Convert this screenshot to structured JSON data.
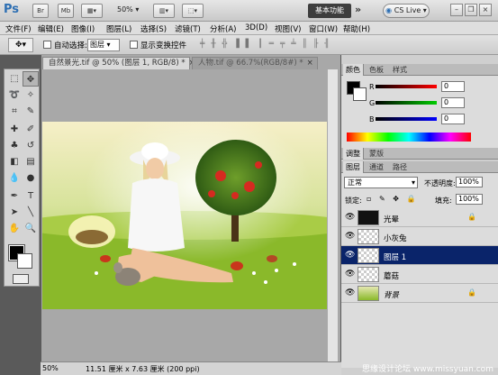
{
  "app": {
    "logo": "Ps",
    "zoom": "50%",
    "workspace": "基本功能",
    "cs_live": "CS Live",
    "titlebar_buttons": [
      "Br",
      "Mb"
    ]
  },
  "menu": [
    "文件(F)",
    "编辑(E)",
    "图像(I)",
    "图层(L)",
    "选择(S)",
    "滤镜(T)",
    "分析(A)",
    "3D(D)",
    "视图(V)",
    "窗口(W)",
    "帮助(H)"
  ],
  "options": {
    "auto_select_label": "自动选择:",
    "auto_select_value": "图层",
    "show_transform_label": "显示变换控件"
  },
  "tabs": [
    {
      "label": "自然景光.tif @ 50% (图层 1, RGB/8) *",
      "close": "×"
    },
    {
      "label": "人物.tif @ 66.7%(RGB/8#) *",
      "close": "×"
    }
  ],
  "status": {
    "zoom": "50%",
    "info": "11.51 厘米 x 7.63 厘米 (200 ppi)"
  },
  "color_panel": {
    "tabs": [
      "颜色",
      "色板",
      "样式"
    ],
    "channels": [
      {
        "label": "R",
        "value": "0",
        "color": "#e02020"
      },
      {
        "label": "G",
        "value": "0",
        "color": "#20b020"
      },
      {
        "label": "B",
        "value": "0",
        "color": "#2040e0"
      }
    ]
  },
  "adjust_tabs": [
    "调整",
    "蒙版"
  ],
  "layers_panel": {
    "tabs": [
      "图层",
      "通道",
      "路径"
    ],
    "blend_mode": "正常",
    "opacity_label": "不透明度:",
    "opacity_value": "100%",
    "lock_label": "锁定:",
    "fill_label": "填充:",
    "fill_value": "100%",
    "layers": [
      {
        "name": "光晕",
        "selected": false,
        "locked": true
      },
      {
        "name": "小灰兔",
        "selected": false,
        "locked": false
      },
      {
        "name": "图层 1",
        "selected": true,
        "locked": false
      },
      {
        "name": "蘑菇",
        "selected": false,
        "locked": false
      },
      {
        "name": "背景",
        "selected": false,
        "locked": true
      }
    ]
  },
  "watermark": "思缘设计论坛 www.missyuan.com"
}
